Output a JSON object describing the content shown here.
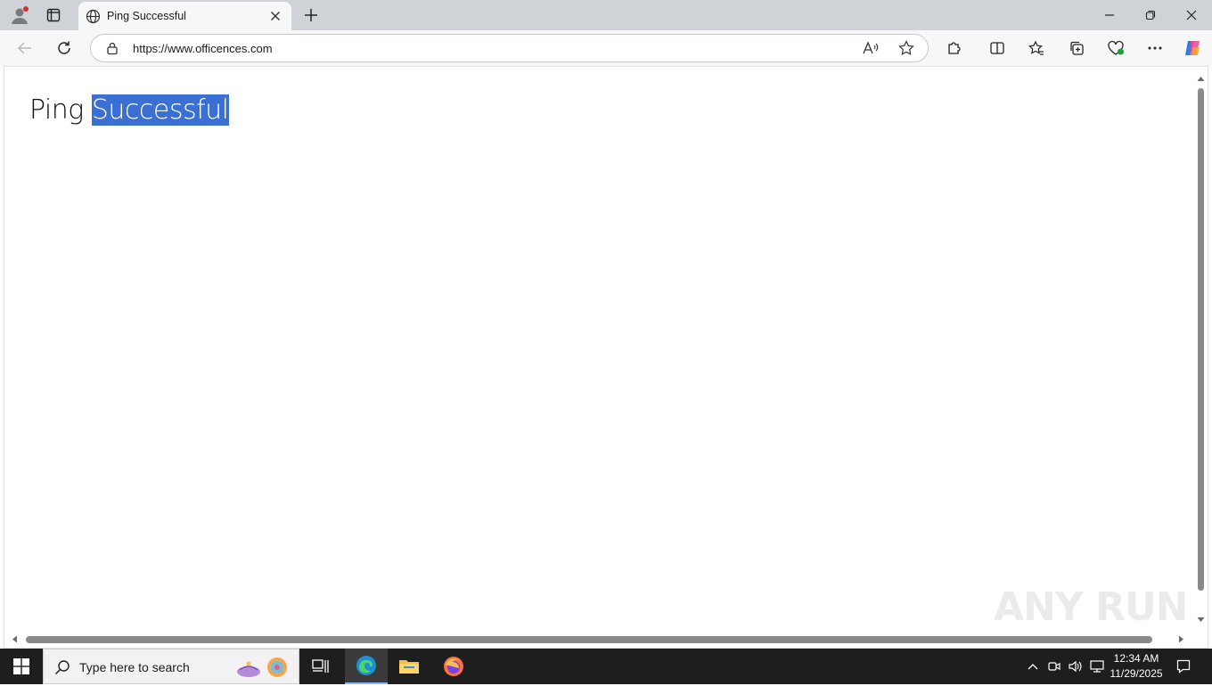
{
  "browser": {
    "tab": {
      "title": "Ping Successful"
    },
    "address_bar": {
      "url": "https://www.officences.com"
    }
  },
  "page": {
    "heading_plain": "Ping ",
    "heading_selected": "Successful"
  },
  "watermark": {
    "text": "ANY RUN"
  },
  "taskbar": {
    "search_placeholder": "Type here to search",
    "clock": {
      "time": "12:34 AM",
      "date": "11/29/2025"
    }
  },
  "colors": {
    "selection": "#3a6fd3",
    "taskbar": "#1e1e1e",
    "tabstrip": "#cfd3d8"
  }
}
